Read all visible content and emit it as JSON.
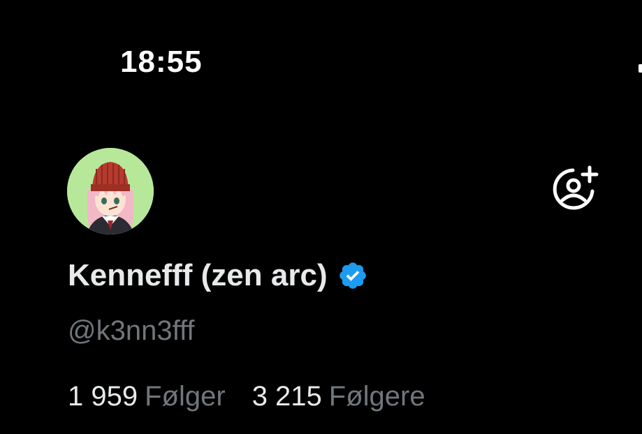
{
  "status_bar": {
    "time": "18:55"
  },
  "profile": {
    "display_name": "Kennefff (zen arc)",
    "handle": "@k3nn3fff",
    "verified": true,
    "avatar_bg_color": "#b7e89a"
  },
  "stats": {
    "following_count": "1 959",
    "following_label": "Følger",
    "followers_count": "3 215",
    "followers_label": "Følgere"
  },
  "icons": {
    "follow": "add-person-icon",
    "verified": "verified-badge-icon"
  },
  "colors": {
    "background": "#000000",
    "text_primary": "#e7e9ea",
    "text_secondary": "#71767b",
    "verified_blue": "#1d9bf0"
  }
}
